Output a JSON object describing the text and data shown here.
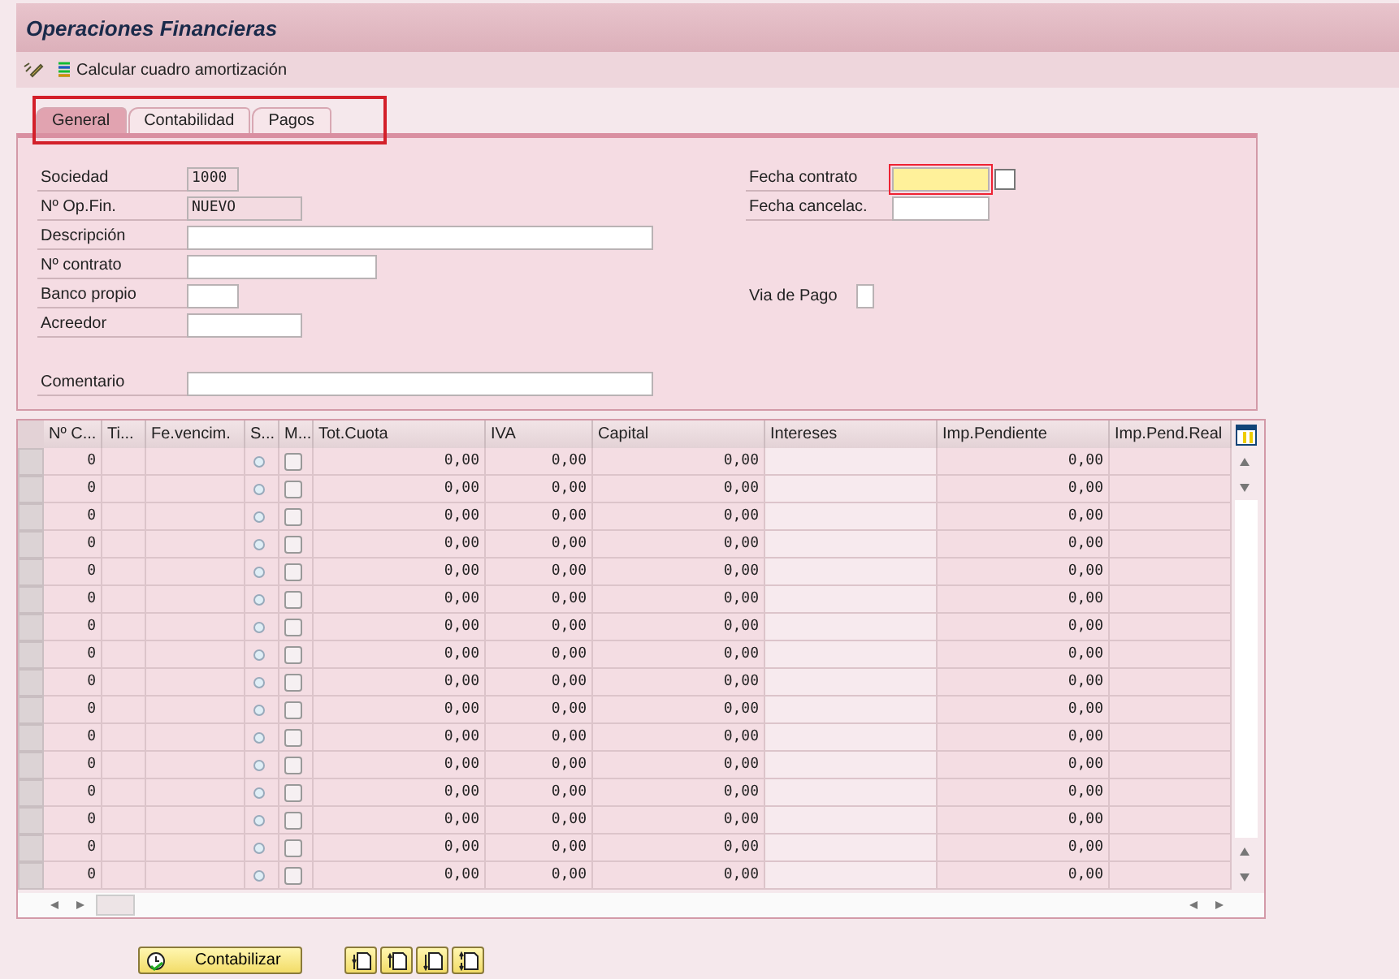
{
  "window": {
    "title": "Operaciones Financieras"
  },
  "toolbar": {
    "action": "Calcular cuadro amortización"
  },
  "tabs": [
    {
      "label": "General",
      "selected": true
    },
    {
      "label": "Contabilidad",
      "selected": false
    },
    {
      "label": "Pagos",
      "selected": false
    }
  ],
  "form_left": [
    {
      "label": "Sociedad",
      "value": "1000",
      "kind": "readonly"
    },
    {
      "label": "Nº Op.Fin.",
      "value": "NUEVO",
      "kind": "readonly"
    },
    {
      "label": "Descripción",
      "kind": "input"
    },
    {
      "label": "Nº contrato",
      "kind": "input"
    },
    {
      "label": "Banco propio",
      "kind": "input"
    },
    {
      "label": "Acreedor",
      "kind": "input"
    }
  ],
  "comment": {
    "label": "Comentario"
  },
  "form_right": [
    {
      "label": "Fecha contrato",
      "focused": true,
      "kind": "date_help"
    },
    {
      "label": "Fecha cancelac.",
      "focused": false,
      "kind": "date"
    }
  ],
  "payment": {
    "label": "Via de Pago"
  },
  "table": {
    "columns": [
      {
        "label": "Nº C...",
        "kind": "num"
      },
      {
        "label": "Ti...",
        "kind": "text"
      },
      {
        "label": "Fe.vencim.",
        "kind": "text"
      },
      {
        "label": "S...",
        "kind": "radio"
      },
      {
        "label": "M...",
        "kind": "check"
      },
      {
        "label": "Tot.Cuota",
        "kind": "num"
      },
      {
        "label": "IVA",
        "kind": "num"
      },
      {
        "label": "Capital",
        "kind": "num"
      },
      {
        "label": "Intereses",
        "kind": "light"
      },
      {
        "label": "Imp.Pendiente",
        "kind": "num"
      },
      {
        "label": "Imp.Pend.Real",
        "kind": "num"
      }
    ],
    "rows": [
      {
        "cells": [
          "0",
          null,
          null,
          null,
          null,
          "0,00",
          "0,00",
          "0,00",
          null,
          "0,00",
          null
        ],
        "checked": false
      },
      {
        "cells": [
          "0",
          null,
          null,
          null,
          null,
          "0,00",
          "0,00",
          "0,00",
          null,
          "0,00",
          null
        ],
        "checked": false
      },
      {
        "cells": [
          "0",
          null,
          null,
          null,
          null,
          "0,00",
          "0,00",
          "0,00",
          null,
          "0,00",
          null
        ],
        "checked": false
      },
      {
        "cells": [
          "0",
          null,
          null,
          null,
          null,
          "0,00",
          "0,00",
          "0,00",
          null,
          "0,00",
          null
        ],
        "checked": false
      },
      {
        "cells": [
          "0",
          null,
          null,
          null,
          null,
          "0,00",
          "0,00",
          "0,00",
          null,
          "0,00",
          null
        ],
        "checked": false
      },
      {
        "cells": [
          "0",
          null,
          null,
          null,
          null,
          "0,00",
          "0,00",
          "0,00",
          null,
          "0,00",
          null
        ],
        "checked": false
      },
      {
        "cells": [
          "0",
          null,
          null,
          null,
          null,
          "0,00",
          "0,00",
          "0,00",
          null,
          "0,00",
          null
        ],
        "checked": false
      },
      {
        "cells": [
          "0",
          null,
          null,
          null,
          null,
          "0,00",
          "0,00",
          "0,00",
          null,
          "0,00",
          null
        ],
        "checked": false
      },
      {
        "cells": [
          "0",
          null,
          null,
          null,
          null,
          "0,00",
          "0,00",
          "0,00",
          null,
          "0,00",
          null
        ],
        "checked": false
      },
      {
        "cells": [
          "0",
          null,
          null,
          null,
          null,
          "0,00",
          "0,00",
          "0,00",
          null,
          "0,00",
          null
        ],
        "checked": false
      },
      {
        "cells": [
          "0",
          null,
          null,
          null,
          null,
          "0,00",
          "0,00",
          "0,00",
          null,
          "0,00",
          null
        ],
        "checked": false
      },
      {
        "cells": [
          "0",
          null,
          null,
          null,
          null,
          "0,00",
          "0,00",
          "0,00",
          null,
          "0,00",
          null
        ],
        "checked": false
      },
      {
        "cells": [
          "0",
          null,
          null,
          null,
          null,
          "0,00",
          "0,00",
          "0,00",
          null,
          "0,00",
          null
        ],
        "checked": false
      },
      {
        "cells": [
          "0",
          null,
          null,
          null,
          null,
          "0,00",
          "0,00",
          "0,00",
          null,
          "0,00",
          null
        ],
        "checked": false
      },
      {
        "cells": [
          "0",
          null,
          null,
          null,
          null,
          "0,00",
          "0,00",
          "0,00",
          null,
          "0,00",
          null
        ],
        "checked": false
      },
      {
        "cells": [
          "0",
          null,
          null,
          null,
          null,
          "0,00",
          "0,00",
          "0,00",
          null,
          "0,00",
          null
        ],
        "checked": false
      }
    ]
  },
  "footer": {
    "post_button": "Contabilizar"
  }
}
